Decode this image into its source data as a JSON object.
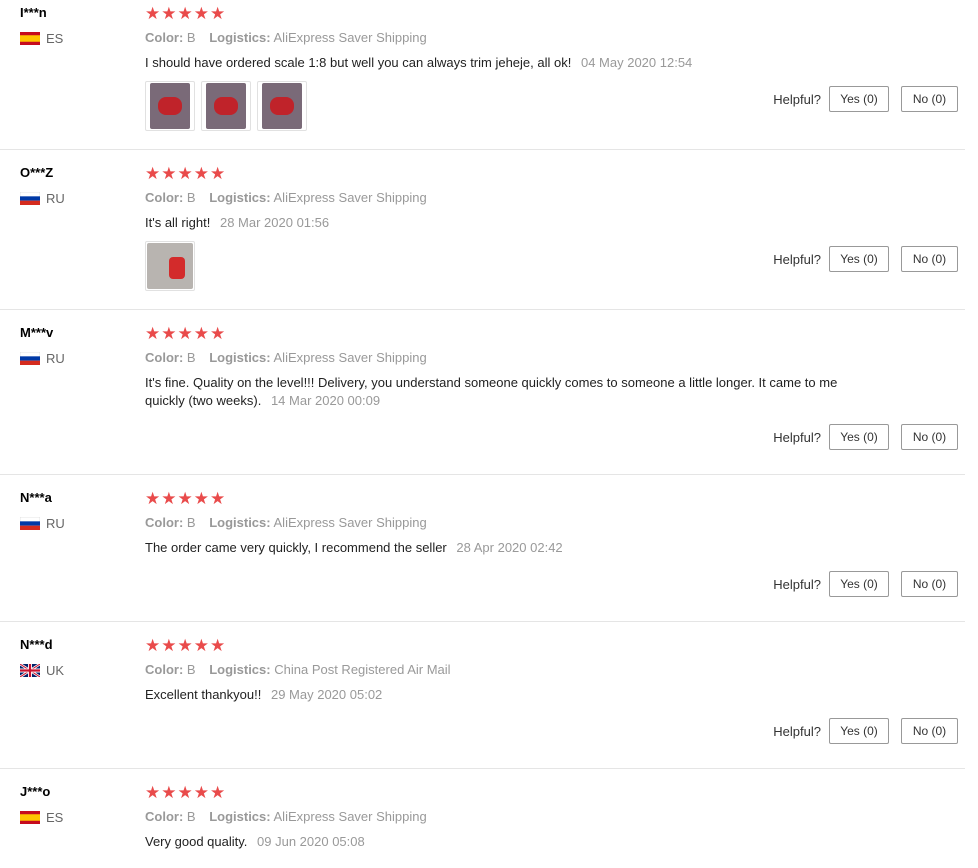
{
  "common": {
    "stars": "★★★★★",
    "color_key": "Color:",
    "logistics_key": "Logistics:",
    "helpful": "Helpful?",
    "yes": "Yes (0)",
    "no": "No (0)"
  },
  "reviews": [
    {
      "user": "I***n",
      "country": "ES",
      "color": "B",
      "logistics": "AliExpress Saver Shipping",
      "text": "I should have ordered scale 1:8 but well you can always trim jeheje, all ok!",
      "date": "04 May 2020 12:54",
      "photo_count": 3
    },
    {
      "user": "O***Z",
      "country": "RU",
      "color": "B",
      "logistics": "AliExpress Saver Shipping",
      "text": "It's all right!",
      "date": "28 Mar 2020 01:56",
      "photo_count": 1
    },
    {
      "user": "M***v",
      "country": "RU",
      "color": "B",
      "logistics": "AliExpress Saver Shipping",
      "text": "It's fine. Quality on the level!!! Delivery, you understand someone quickly comes to someone a little longer. It came to me quickly (two weeks).",
      "date": "14 Mar 2020 00:09",
      "photo_count": 0
    },
    {
      "user": "N***a",
      "country": "RU",
      "color": "B",
      "logistics": "AliExpress Saver Shipping",
      "text": "The order came very quickly, I recommend the seller",
      "date": "28 Apr 2020 02:42",
      "photo_count": 0
    },
    {
      "user": "N***d",
      "country": "UK",
      "color": "B",
      "logistics": "China Post Registered Air Mail",
      "text": "Excellent thankyou!!",
      "date": "29 May 2020 05:02",
      "photo_count": 0
    },
    {
      "user": "J***o",
      "country": "ES",
      "color": "B",
      "logistics": "AliExpress Saver Shipping",
      "text": "Very good quality.",
      "date": "09 Jun 2020 05:08",
      "photo_count": 0
    }
  ],
  "colors": {
    "star": "#e94b4b",
    "divider": "#e5e5e5",
    "muted": "#999999"
  }
}
